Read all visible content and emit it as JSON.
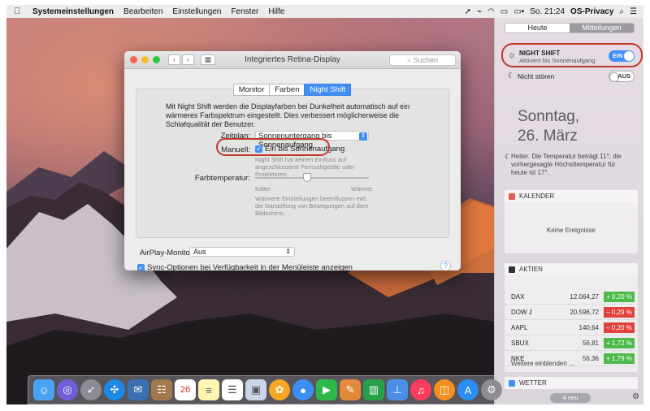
{
  "menubar": {
    "apple": "",
    "app": "Systemeinstellungen",
    "items": [
      "Bearbeiten",
      "Einstellungen",
      "Fenster",
      "Hilfe"
    ],
    "clock": "So. 21:24",
    "user": "OS-Privacy"
  },
  "window": {
    "title": "Integriertes Retina-Display",
    "search_placeholder": "Suchen",
    "tabs": [
      "Monitor",
      "Farben",
      "Night Shift"
    ],
    "active_tab": "Night Shift",
    "intro": "Mit Night Shift werden die Displayfarben bei Dunkelheit automatisch auf ein wärmeres Farbspektrum eingestellt. Dies verbessert möglicherweise die Schlafqualität der Benutzer.",
    "schedule_label": "Zeitplan:",
    "schedule_value": "Sonnenuntergang bis Sonnenaufgang",
    "manual_label": "Manuell:",
    "manual_checkbox": "Ein bis Sonnenaufgang",
    "manual_note": "Night Shift hat keinen Einfluss auf angeschlossene Fernsehgeräte oder Projektoren.",
    "temp_label": "Farbtemperatur:",
    "temp_cold": "Kälter",
    "temp_warm": "Wärmer",
    "temp_level": 0.45,
    "temp_note": "Wärmere Einstellungen beeinflussen evtl. die Darstellung von Bewegungen auf dem Bildschirm.",
    "airplay_label": "AirPlay-Monitor:",
    "airplay_value": "Aus",
    "sync_label": "Sync-Optionen bei Verfügbarkeit in der Menüleiste anzeigen",
    "help": "?"
  },
  "notification_center": {
    "tabs": [
      "Heute",
      "Mitteilungen"
    ],
    "night_shift_title": "NIGHT SHIFT",
    "night_shift_sub": "Aktiviert bis Sonnenaufgang",
    "night_shift_toggle": "EIN",
    "dnd_label": "Nicht stören",
    "dnd_toggle": "AUS",
    "date_line1": "Sonntag,",
    "date_line2": "26. März",
    "weather": "Heiter. Die Temperatur beträgt 11°; die vorhergesagte Höchsttemperatur für heute ist 17°.",
    "calendar_title": "KALENDER",
    "calendar_empty": "Keine Ereignisse",
    "stocks_title": "AKTIEN",
    "stocks": [
      {
        "sym": "DAX",
        "price": "12.064,27",
        "change": "+ 0,20 %",
        "up": true
      },
      {
        "sym": "DOW J",
        "price": "20.596,72",
        "change": "– 0,29 %",
        "up": false
      },
      {
        "sym": "AAPL",
        "price": "140,64",
        "change": "– 0,20 %",
        "up": false
      },
      {
        "sym": "SBUX",
        "price": "56,81",
        "change": "+ 1,72 %",
        "up": true
      },
      {
        "sym": "NKE",
        "price": "56,36",
        "change": "+ 1,79 %",
        "up": true
      }
    ],
    "stocks_more": "Weitere einblenden ...",
    "weather_title": "WETTER",
    "new_count": "4 neu"
  },
  "colors": {
    "accent": "#3f8ff5",
    "up": "#4cbb4a",
    "down": "#e0423a",
    "annotation": "#c0392b"
  }
}
